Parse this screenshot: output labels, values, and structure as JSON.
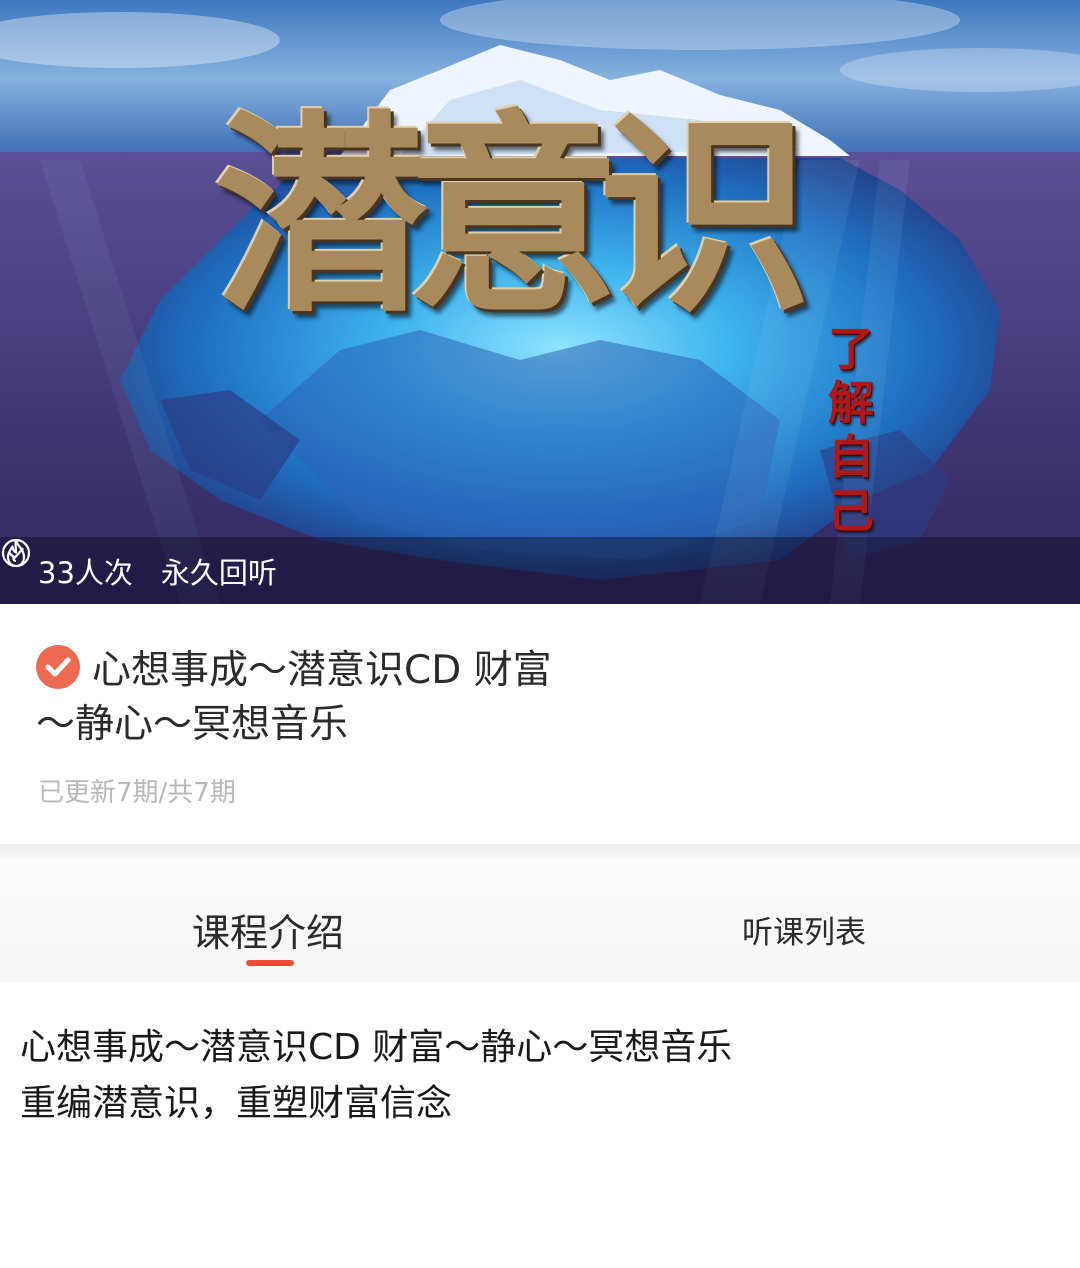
{
  "cover": {
    "title": "潜意识",
    "subtitle": "了解自己"
  },
  "stats": {
    "heat_icon": "flame-icon",
    "heat_text": "33人次",
    "forever_icon": "check-circle-icon",
    "forever_text": "永久回听"
  },
  "course": {
    "badge_icon": "verified-badge-icon",
    "badge_color": "#ec6a52",
    "title": "心想事成～潜意识CD 财富～静心～冥想音乐",
    "update_status": "已更新7期/共7期"
  },
  "tabs": [
    {
      "label": "课程介绍",
      "active": true
    },
    {
      "label": "听课列表",
      "active": false
    }
  ],
  "accent_color": "#e94e38",
  "description": {
    "line1": "心想事成～潜意识CD 财富～静心～冥想音乐",
    "line2": "重编潜意识，重塑财富信念"
  }
}
